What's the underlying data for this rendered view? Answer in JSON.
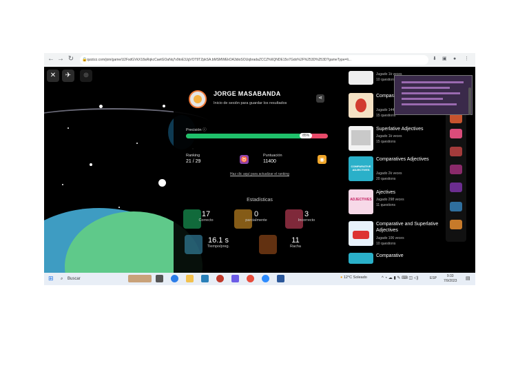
{
  "browser": {
    "url": "quizizz.com/join/game/U2FsdGVkX18aRqkcCaetGOaNq7v9toE3JgVOT9TZpkSA.bMSMWEkOA3dioSOUqbradaZCCZ%6QNDE15o7Gdo%2F%253D%253D?gameType=li...",
    "back_icon": "arrow-left-icon",
    "forward_icon": "arrow-right-icon",
    "reload_icon": "reload-icon"
  },
  "game": {
    "close_label": "✕",
    "player": {
      "name": "JORGE MASABANDA",
      "login_prompt": "Inicio de sesión para guardar los resultados"
    },
    "precision": {
      "label": "Precisión",
      "percent": 85,
      "percent_text": "85%"
    },
    "ranking": {
      "label": "Ranking",
      "value": "21 / 29"
    },
    "score": {
      "label": "Puntuación",
      "value": "11400"
    },
    "ranking_link": "Haz clic aquí para actualizar el ranking",
    "stats": {
      "title": "Estadísticas",
      "correct": {
        "value": "17",
        "label": "Correcto"
      },
      "partial": {
        "value": "0",
        "label": "parcialmente"
      },
      "incorrect": {
        "value": "3",
        "label": "Incorrecto"
      },
      "time": {
        "value": "16.1 s",
        "label": "Tiempo/preg."
      },
      "streak": {
        "value": "11",
        "label": "Racha"
      }
    }
  },
  "sidebar": {
    "items": [
      {
        "title": "",
        "played": "Jugado 1k veces",
        "questions": "10 questions"
      },
      {
        "title": "Comparative and Superlative",
        "played": "Jugado 144 veces",
        "questions": "15 questions"
      },
      {
        "title": "Superlative Adjectives",
        "played": "Jugado 1k veces",
        "questions": "15 questions"
      },
      {
        "title": "Comparatives Adjectives",
        "played": "Jugado 2k veces",
        "questions": "20 questions"
      },
      {
        "title": "Ajectives",
        "played": "Jugado 298 veces",
        "questions": "11 questions"
      },
      {
        "title": "Comparative and Superlative Adjectives",
        "played": "Jugado 106 veces",
        "questions": "10 questions"
      },
      {
        "title": "Comparative",
        "played": "",
        "questions": ""
      }
    ],
    "thumb_texts": {
      "comparative": "COMPARATIVE ADJECTIVES",
      "adjectives": "ADJECTIVES"
    }
  },
  "taskbar": {
    "search_placeholder": "Buscar",
    "weather": "12°C  Soleado",
    "language": "ESP",
    "time": "9:33",
    "date": "7/9/2023"
  },
  "colors": {
    "correct": "#1fc16b",
    "incorrect": "#e84a6a",
    "accent_purple": "#8e44ad",
    "accent_gold": "#f0a62a"
  }
}
